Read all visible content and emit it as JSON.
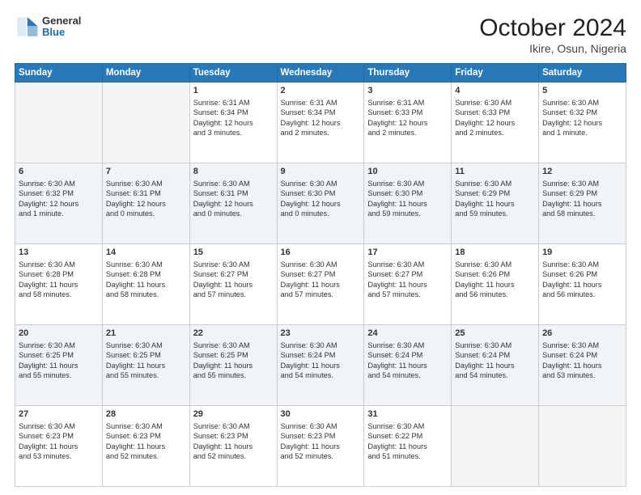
{
  "header": {
    "logo_general": "General",
    "logo_blue": "Blue",
    "title": "October 2024",
    "location": "Ikire, Osun, Nigeria"
  },
  "days_of_week": [
    "Sunday",
    "Monday",
    "Tuesday",
    "Wednesday",
    "Thursday",
    "Friday",
    "Saturday"
  ],
  "weeks": [
    {
      "shade": false,
      "days": [
        {
          "num": "",
          "empty": true,
          "lines": []
        },
        {
          "num": "",
          "empty": true,
          "lines": []
        },
        {
          "num": "1",
          "empty": false,
          "lines": [
            "Sunrise: 6:31 AM",
            "Sunset: 6:34 PM",
            "Daylight: 12 hours",
            "and 3 minutes."
          ]
        },
        {
          "num": "2",
          "empty": false,
          "lines": [
            "Sunrise: 6:31 AM",
            "Sunset: 6:34 PM",
            "Daylight: 12 hours",
            "and 2 minutes."
          ]
        },
        {
          "num": "3",
          "empty": false,
          "lines": [
            "Sunrise: 6:31 AM",
            "Sunset: 6:33 PM",
            "Daylight: 12 hours",
            "and 2 minutes."
          ]
        },
        {
          "num": "4",
          "empty": false,
          "lines": [
            "Sunrise: 6:30 AM",
            "Sunset: 6:33 PM",
            "Daylight: 12 hours",
            "and 2 minutes."
          ]
        },
        {
          "num": "5",
          "empty": false,
          "lines": [
            "Sunrise: 6:30 AM",
            "Sunset: 6:32 PM",
            "Daylight: 12 hours",
            "and 1 minute."
          ]
        }
      ]
    },
    {
      "shade": true,
      "days": [
        {
          "num": "6",
          "empty": false,
          "lines": [
            "Sunrise: 6:30 AM",
            "Sunset: 6:32 PM",
            "Daylight: 12 hours",
            "and 1 minute."
          ]
        },
        {
          "num": "7",
          "empty": false,
          "lines": [
            "Sunrise: 6:30 AM",
            "Sunset: 6:31 PM",
            "Daylight: 12 hours",
            "and 0 minutes."
          ]
        },
        {
          "num": "8",
          "empty": false,
          "lines": [
            "Sunrise: 6:30 AM",
            "Sunset: 6:31 PM",
            "Daylight: 12 hours",
            "and 0 minutes."
          ]
        },
        {
          "num": "9",
          "empty": false,
          "lines": [
            "Sunrise: 6:30 AM",
            "Sunset: 6:30 PM",
            "Daylight: 12 hours",
            "and 0 minutes."
          ]
        },
        {
          "num": "10",
          "empty": false,
          "lines": [
            "Sunrise: 6:30 AM",
            "Sunset: 6:30 PM",
            "Daylight: 11 hours",
            "and 59 minutes."
          ]
        },
        {
          "num": "11",
          "empty": false,
          "lines": [
            "Sunrise: 6:30 AM",
            "Sunset: 6:29 PM",
            "Daylight: 11 hours",
            "and 59 minutes."
          ]
        },
        {
          "num": "12",
          "empty": false,
          "lines": [
            "Sunrise: 6:30 AM",
            "Sunset: 6:29 PM",
            "Daylight: 11 hours",
            "and 58 minutes."
          ]
        }
      ]
    },
    {
      "shade": false,
      "days": [
        {
          "num": "13",
          "empty": false,
          "lines": [
            "Sunrise: 6:30 AM",
            "Sunset: 6:28 PM",
            "Daylight: 11 hours",
            "and 58 minutes."
          ]
        },
        {
          "num": "14",
          "empty": false,
          "lines": [
            "Sunrise: 6:30 AM",
            "Sunset: 6:28 PM",
            "Daylight: 11 hours",
            "and 58 minutes."
          ]
        },
        {
          "num": "15",
          "empty": false,
          "lines": [
            "Sunrise: 6:30 AM",
            "Sunset: 6:27 PM",
            "Daylight: 11 hours",
            "and 57 minutes."
          ]
        },
        {
          "num": "16",
          "empty": false,
          "lines": [
            "Sunrise: 6:30 AM",
            "Sunset: 6:27 PM",
            "Daylight: 11 hours",
            "and 57 minutes."
          ]
        },
        {
          "num": "17",
          "empty": false,
          "lines": [
            "Sunrise: 6:30 AM",
            "Sunset: 6:27 PM",
            "Daylight: 11 hours",
            "and 57 minutes."
          ]
        },
        {
          "num": "18",
          "empty": false,
          "lines": [
            "Sunrise: 6:30 AM",
            "Sunset: 6:26 PM",
            "Daylight: 11 hours",
            "and 56 minutes."
          ]
        },
        {
          "num": "19",
          "empty": false,
          "lines": [
            "Sunrise: 6:30 AM",
            "Sunset: 6:26 PM",
            "Daylight: 11 hours",
            "and 56 minutes."
          ]
        }
      ]
    },
    {
      "shade": true,
      "days": [
        {
          "num": "20",
          "empty": false,
          "lines": [
            "Sunrise: 6:30 AM",
            "Sunset: 6:25 PM",
            "Daylight: 11 hours",
            "and 55 minutes."
          ]
        },
        {
          "num": "21",
          "empty": false,
          "lines": [
            "Sunrise: 6:30 AM",
            "Sunset: 6:25 PM",
            "Daylight: 11 hours",
            "and 55 minutes."
          ]
        },
        {
          "num": "22",
          "empty": false,
          "lines": [
            "Sunrise: 6:30 AM",
            "Sunset: 6:25 PM",
            "Daylight: 11 hours",
            "and 55 minutes."
          ]
        },
        {
          "num": "23",
          "empty": false,
          "lines": [
            "Sunrise: 6:30 AM",
            "Sunset: 6:24 PM",
            "Daylight: 11 hours",
            "and 54 minutes."
          ]
        },
        {
          "num": "24",
          "empty": false,
          "lines": [
            "Sunrise: 6:30 AM",
            "Sunset: 6:24 PM",
            "Daylight: 11 hours",
            "and 54 minutes."
          ]
        },
        {
          "num": "25",
          "empty": false,
          "lines": [
            "Sunrise: 6:30 AM",
            "Sunset: 6:24 PM",
            "Daylight: 11 hours",
            "and 54 minutes."
          ]
        },
        {
          "num": "26",
          "empty": false,
          "lines": [
            "Sunrise: 6:30 AM",
            "Sunset: 6:24 PM",
            "Daylight: 11 hours",
            "and 53 minutes."
          ]
        }
      ]
    },
    {
      "shade": false,
      "days": [
        {
          "num": "27",
          "empty": false,
          "lines": [
            "Sunrise: 6:30 AM",
            "Sunset: 6:23 PM",
            "Daylight: 11 hours",
            "and 53 minutes."
          ]
        },
        {
          "num": "28",
          "empty": false,
          "lines": [
            "Sunrise: 6:30 AM",
            "Sunset: 6:23 PM",
            "Daylight: 11 hours",
            "and 52 minutes."
          ]
        },
        {
          "num": "29",
          "empty": false,
          "lines": [
            "Sunrise: 6:30 AM",
            "Sunset: 6:23 PM",
            "Daylight: 11 hours",
            "and 52 minutes."
          ]
        },
        {
          "num": "30",
          "empty": false,
          "lines": [
            "Sunrise: 6:30 AM",
            "Sunset: 6:23 PM",
            "Daylight: 11 hours",
            "and 52 minutes."
          ]
        },
        {
          "num": "31",
          "empty": false,
          "lines": [
            "Sunrise: 6:30 AM",
            "Sunset: 6:22 PM",
            "Daylight: 11 hours",
            "and 51 minutes."
          ]
        },
        {
          "num": "",
          "empty": true,
          "lines": []
        },
        {
          "num": "",
          "empty": true,
          "lines": []
        }
      ]
    }
  ]
}
